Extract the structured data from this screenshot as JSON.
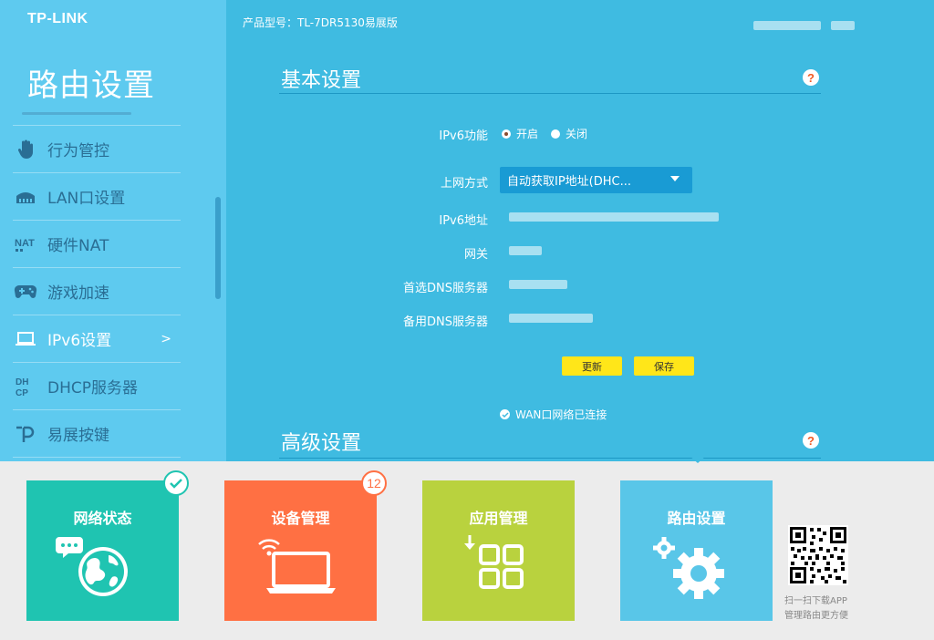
{
  "brand": {
    "logo": "TP-LINK"
  },
  "sidebar": {
    "title": "路由设置",
    "items": [
      {
        "label": "行为管控",
        "icon": "hand-icon",
        "active": false
      },
      {
        "label": "LAN口设置",
        "icon": "lan-icon",
        "active": false
      },
      {
        "label": "硬件NAT",
        "icon": "nat-icon",
        "active": false
      },
      {
        "label": "游戏加速",
        "icon": "gamepad-icon",
        "active": false
      },
      {
        "label": "IPv6设置",
        "icon": "laptop-icon",
        "active": true,
        "arrow": ">"
      },
      {
        "label": "DHCP服务器",
        "icon": "dhcp-icon",
        "active": false
      },
      {
        "label": "易展按键",
        "icon": "easymesh-icon",
        "active": false
      }
    ]
  },
  "header": {
    "product": "产品型号：TL-7DR5130易展版"
  },
  "basic": {
    "title": "基本设置",
    "help": "?",
    "ipv6_label": "IPv6功能",
    "ipv6_on": "开启",
    "ipv6_off": "关闭",
    "ipv6_enabled": true,
    "conn_label": "上网方式",
    "conn_value": "自动获取IP地址(DHC...",
    "addr_label": "IPv6地址",
    "gateway_label": "网关",
    "dns1_label": "首选DNS服务器",
    "dns2_label": "备用DNS服务器",
    "refresh_btn": "更新",
    "save_btn": "保存",
    "status": "WAN口网络已连接"
  },
  "advanced": {
    "title": "高级设置",
    "help": "?"
  },
  "tiles": [
    {
      "label": "网络状态",
      "color": "#1fc4b1",
      "icon": "globe-chat-icon"
    },
    {
      "label": "设备管理",
      "color": "#ff7043",
      "icon": "laptop-wifi-icon",
      "badge": "12"
    },
    {
      "label": "应用管理",
      "color": "#b9d23e",
      "icon": "apps-grid-icon"
    },
    {
      "label": "路由设置",
      "color": "#59c6e8",
      "icon": "gears-icon",
      "active": true
    }
  ],
  "qr": {
    "line1": "扫一扫下载APP",
    "line2": "管理路由更方便"
  },
  "colors": {
    "sidebar": "#5ecaef",
    "main": "#3fbbe1",
    "button": "#ffe619",
    "help_mark": "#f15a24"
  }
}
